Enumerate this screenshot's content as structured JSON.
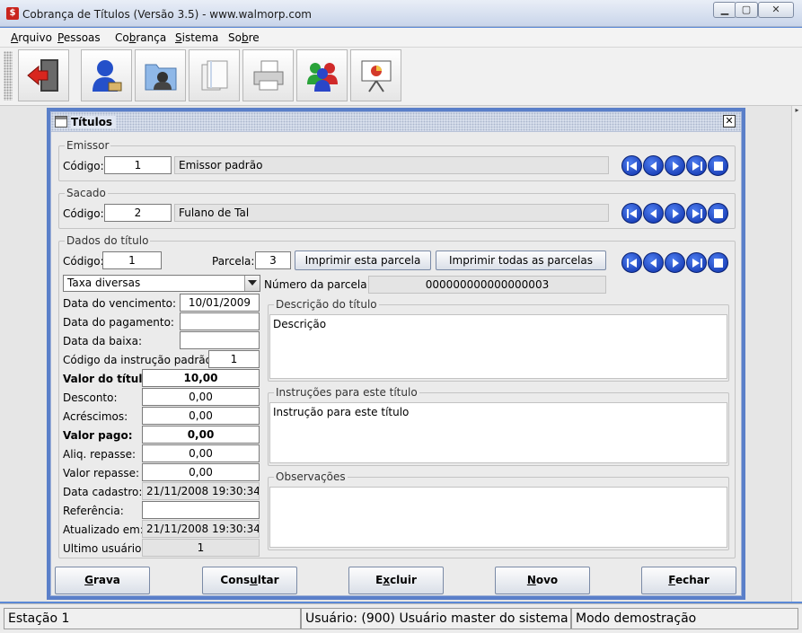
{
  "window": {
    "title": "Cobrança de Títulos (Versão 3.5) - www.walmorp.com",
    "app_icon_glyph": "$",
    "minimize_glyph": "▁",
    "maximize_glyph": "▢",
    "close_glyph": "✕"
  },
  "menu": [
    {
      "pre": "",
      "key": "A",
      "post": "rquivo"
    },
    {
      "pre": "",
      "key": "P",
      "post": "essoas"
    },
    {
      "pre": "Co",
      "key": "b",
      "post": "rança"
    },
    {
      "pre": "",
      "key": "S",
      "post": "istema"
    },
    {
      "pre": "So",
      "key": "b",
      "post": "re"
    }
  ],
  "toolbar": {
    "buttons": [
      "exit-door-icon",
      "user-icon",
      "contacts-folder-icon",
      "documents-icon",
      "printer-icon",
      "users-group-icon",
      "presentation-chart-icon"
    ]
  },
  "frame": {
    "title": "Títulos",
    "close_glyph": "✕"
  },
  "emissor": {
    "legend": "Emissor",
    "code_label": "Código:",
    "code": "1",
    "name": "Emissor padrão"
  },
  "sacado": {
    "legend": "Sacado",
    "code_label": "Código:",
    "code": "2",
    "name": "Fulano de Tal"
  },
  "titulo": {
    "legend": "Dados do título",
    "code_label": "Código:",
    "code": "1",
    "parcela_label": "Parcela:",
    "parcela": "3",
    "print_this": "Imprimir esta parcela",
    "print_all": "Imprimir todas as parcelas",
    "tipo": "Taxa diversas",
    "numero_parcela_label": "Número da parcela:",
    "numero_parcela": "000000000000000003",
    "vencimento_label": "Data do vencimento:",
    "vencimento": "10/01/2009",
    "pagamento_label": "Data do pagamento:",
    "pagamento": "",
    "baixa_label": "Data da baixa:",
    "baixa": "",
    "instrucao_codigo_label": "Código da instrução padrão:",
    "instrucao_codigo": "1",
    "valor_label": "Valor do título:",
    "valor": "10,00",
    "desconto_label": "Desconto:",
    "desconto": "0,00",
    "acrescimos_label": "Acréscimos:",
    "acrescimos": "0,00",
    "valor_pago_label": "Valor pago:",
    "valor_pago": "0,00",
    "aliq_label": "Aliq. repasse:",
    "aliq": "0,00",
    "valor_repasse_label": "Valor repasse:",
    "valor_repasse": "0,00",
    "cadastro_label": "Data cadastro:",
    "cadastro": "21/11/2008 19:30:34",
    "referencia_label": "Referência:",
    "referencia": "",
    "atualizado_label": "Atualizado em:",
    "atualizado": "21/11/2008 19:30:34",
    "usuario_label": "Ultimo usuário",
    "usuario": "1",
    "descricao_legend": "Descrição do título",
    "descricao": "Descrição",
    "instrucoes_legend": "Instruções para este título",
    "instrucoes": "Instrução para este título",
    "observacoes_legend": "Observações",
    "observacoes": ""
  },
  "actions": [
    {
      "pre": "",
      "key": "G",
      "post": "rava"
    },
    {
      "pre": "Cons",
      "key": "u",
      "post": "ltar"
    },
    {
      "pre": "E",
      "key": "x",
      "post": "cluir"
    },
    {
      "pre": "",
      "key": "N",
      "post": "ovo"
    },
    {
      "pre": "",
      "key": "F",
      "post": "echar"
    }
  ],
  "status": {
    "station": "Estação 1",
    "user": "Usuário: (900) Usuário master do sistema",
    "mode": "Modo demostração"
  },
  "desktop_scroll_glyph": "▸",
  "colors": {
    "frame_border": "#5a7fc9",
    "nav_button": "#1a44c8",
    "app_icon": "#c9241d"
  }
}
